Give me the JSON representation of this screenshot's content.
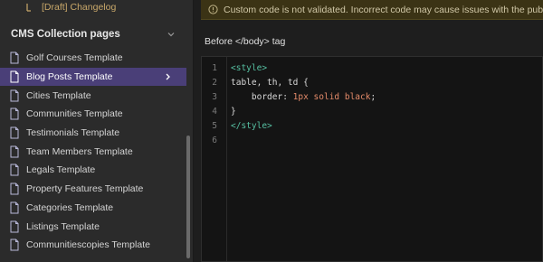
{
  "sidebar": {
    "top_item": {
      "label": "[Draft] Changelog",
      "icon": "draft-page-icon"
    },
    "section_title": "CMS Collection pages",
    "items": [
      {
        "label": "Golf Courses Template",
        "active": false
      },
      {
        "label": "Blog Posts Template",
        "active": true
      },
      {
        "label": "Cities Template",
        "active": false
      },
      {
        "label": "Communities Template",
        "active": false
      },
      {
        "label": "Testimonials Template",
        "active": false
      },
      {
        "label": "Team Members Template",
        "active": false
      },
      {
        "label": "Legals Template",
        "active": false
      },
      {
        "label": "Property Features Template",
        "active": false
      },
      {
        "label": "Categories Template",
        "active": false
      },
      {
        "label": "Listings Template",
        "active": false
      },
      {
        "label": "Communitiescopies Template",
        "active": false
      }
    ]
  },
  "main": {
    "banner_text": "Custom code is not validated. Incorrect code may cause issues with the published site.",
    "field_label": "Before </body> tag",
    "line_numbers": [
      "1",
      "2",
      "3",
      "4",
      "5",
      "6"
    ],
    "code": {
      "l1": "<style>",
      "l2": "table, th, td {",
      "l3_prop": "border: ",
      "l3_value": "1px solid black",
      "l3_end": ";",
      "l4": "}",
      "l5": "</style>"
    }
  },
  "colors": {
    "active_row": "#4a3f78",
    "tag": "#56c0a2",
    "value": "#e58b6a",
    "banner_bg": "#3b3315"
  }
}
